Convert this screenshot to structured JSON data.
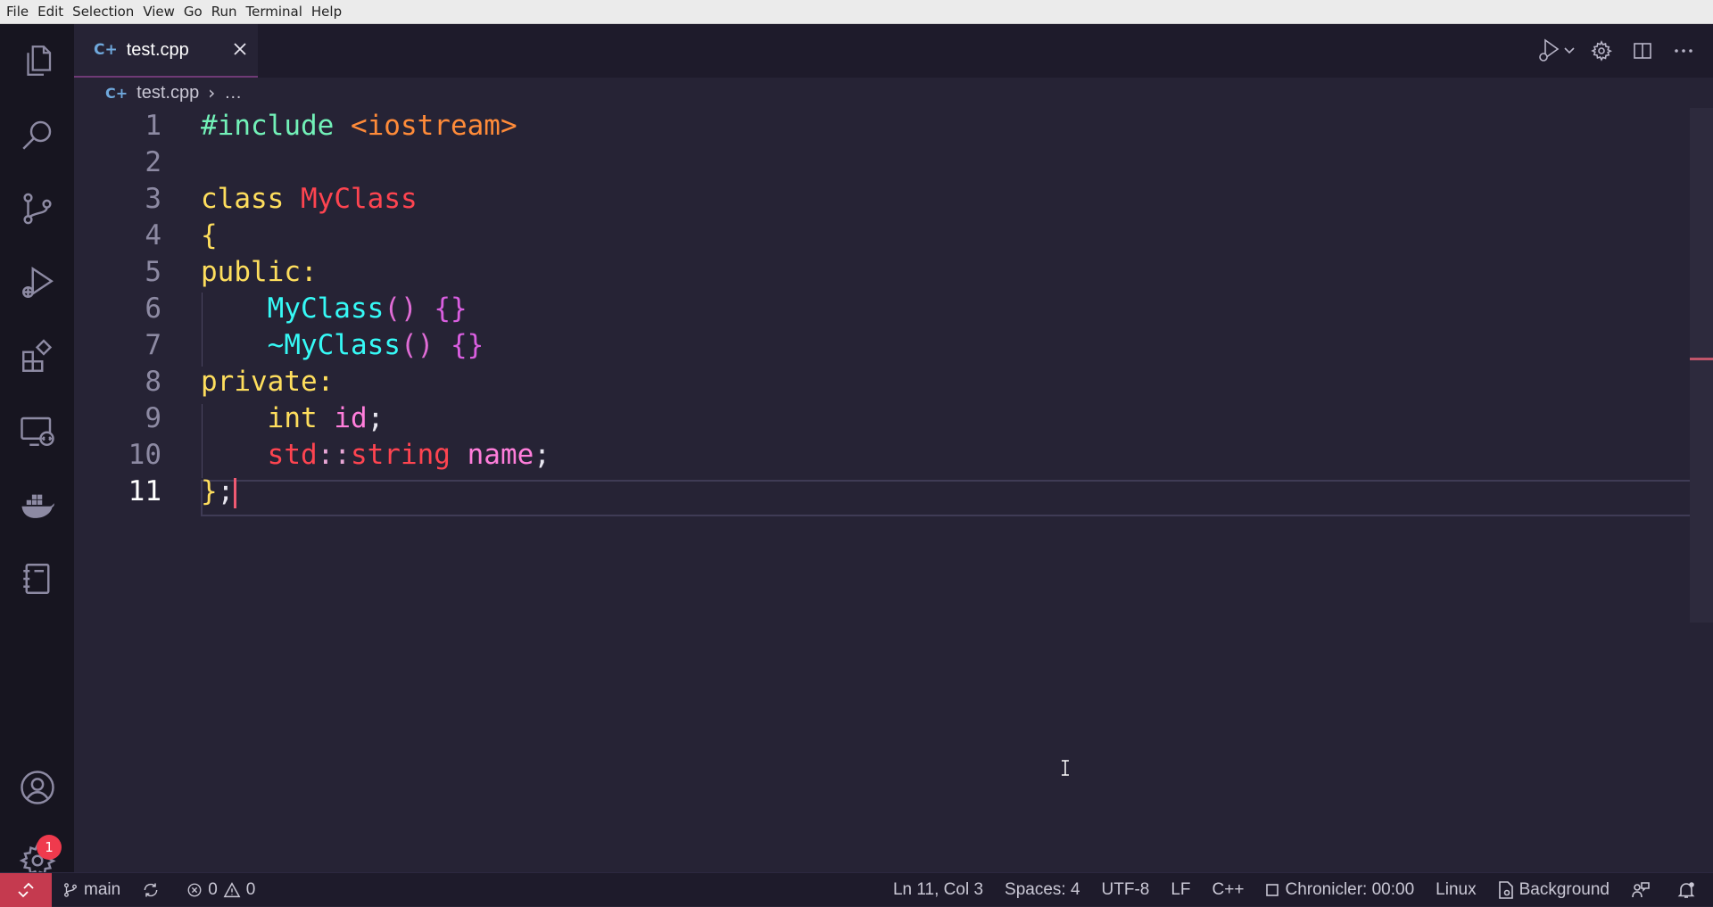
{
  "menubar": {
    "items": [
      "File",
      "Edit",
      "Selection",
      "View",
      "Go",
      "Run",
      "Terminal",
      "Help"
    ]
  },
  "activity_bar": {
    "icons": [
      "explorer-icon",
      "search-icon",
      "source-control-icon",
      "run-debug-icon",
      "extensions-icon",
      "remote-explorer-icon",
      "docker-icon",
      "notebook-icon",
      "account-icon",
      "settings-gear-icon"
    ],
    "settings_badge": "1"
  },
  "tab": {
    "icon_glyph": "C+",
    "label": "test.cpp",
    "close_glyph": "✕"
  },
  "breadcrumb": {
    "file": "test.cpp",
    "separator": "›",
    "rest": "…"
  },
  "editor": {
    "line_numbers": [
      "1",
      "2",
      "3",
      "4",
      "5",
      "6",
      "7",
      "8",
      "9",
      "10",
      "11"
    ],
    "active_line": "11",
    "lines": [
      [
        {
          "t": "#include",
          "c": "pre"
        },
        {
          "t": " ",
          "c": "plain"
        },
        {
          "t": "<iostream>",
          "c": "str"
        }
      ],
      [],
      [
        {
          "t": "class",
          "c": "kw"
        },
        {
          "t": " ",
          "c": "plain"
        },
        {
          "t": "MyClass",
          "c": "cls"
        }
      ],
      [
        {
          "t": "{",
          "c": "brace"
        }
      ],
      [
        {
          "t": "public",
          "c": "kw"
        },
        {
          "t": ":",
          "c": "kw"
        }
      ],
      [
        {
          "t": "    ",
          "c": "plain"
        },
        {
          "t": "MyClass",
          "c": "fn"
        },
        {
          "t": "()",
          "c": "paren"
        },
        {
          "t": " ",
          "c": "plain"
        },
        {
          "t": "{}",
          "c": "pbrace"
        }
      ],
      [
        {
          "t": "    ",
          "c": "plain"
        },
        {
          "t": "~MyClass",
          "c": "fn"
        },
        {
          "t": "()",
          "c": "paren"
        },
        {
          "t": " ",
          "c": "plain"
        },
        {
          "t": "{}",
          "c": "pbrace"
        }
      ],
      [
        {
          "t": "private",
          "c": "kw"
        },
        {
          "t": ":",
          "c": "kw"
        }
      ],
      [
        {
          "t": "    ",
          "c": "plain"
        },
        {
          "t": "int",
          "c": "kw"
        },
        {
          "t": " ",
          "c": "plain"
        },
        {
          "t": "id",
          "c": "var"
        },
        {
          "t": ";",
          "c": "plain"
        }
      ],
      [
        {
          "t": "    ",
          "c": "plain"
        },
        {
          "t": "std",
          "c": "cls"
        },
        {
          "t": "::",
          "c": "punc"
        },
        {
          "t": "string",
          "c": "cls"
        },
        {
          "t": " ",
          "c": "plain"
        },
        {
          "t": "name",
          "c": "var"
        },
        {
          "t": ";",
          "c": "plain"
        }
      ],
      [
        {
          "t": "}",
          "c": "brace"
        },
        {
          "t": ";",
          "c": "plain"
        }
      ]
    ]
  },
  "status_bar": {
    "branch": "main",
    "errors": "0",
    "warnings": "0",
    "cursor_position": "Ln 11, Col 3",
    "indentation": "Spaces: 4",
    "encoding": "UTF-8",
    "eol": "LF",
    "language": "C++",
    "chronicler": "Chronicler: 00:00",
    "os": "Linux",
    "background": "Background"
  },
  "colors": {
    "editor_bg": "#262335",
    "activity_bg": "#171520",
    "remote_bg": "#c53a4f",
    "badge": "#ef3a4d"
  }
}
